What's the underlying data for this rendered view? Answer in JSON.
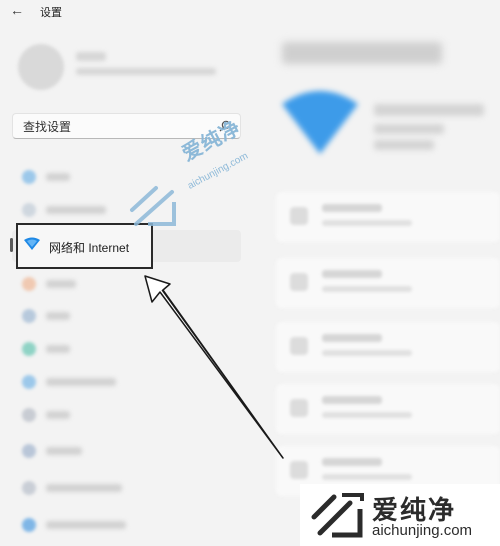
{
  "window": {
    "title": "设置",
    "back_glyph": "←"
  },
  "search": {
    "placeholder": "查找设置"
  },
  "nav": {
    "items": [
      {
        "icon": "system-icon",
        "color": "#9cc8ea",
        "active": false
      },
      {
        "icon": "bluetooth-devices-icon",
        "color": "#cfd7df",
        "active": false
      },
      {
        "icon": "network-internet-icon",
        "color": "#2f8fe0",
        "active": true,
        "label": "网络和 Internet"
      },
      {
        "icon": "personalization-icon",
        "color": "#f0c9b2",
        "active": false
      },
      {
        "icon": "apps-icon",
        "color": "#b7c9dc",
        "active": false
      },
      {
        "icon": "accounts-icon",
        "color": "#8fd3c5",
        "active": false
      },
      {
        "icon": "time-language-icon",
        "color": "#9cc8ea",
        "active": false
      },
      {
        "icon": "gaming-icon",
        "color": "#c8ccd3",
        "active": false
      },
      {
        "icon": "accessibility-icon",
        "color": "#b9c6d8",
        "active": false
      },
      {
        "icon": "privacy-security-icon",
        "color": "#c9ced6",
        "active": false
      },
      {
        "icon": "windows-update-icon",
        "color": "#7fb6e6",
        "active": false
      }
    ]
  },
  "highlight": {
    "label": "网络和 Internet"
  },
  "watermark": {
    "mid_text": "爱纯净",
    "mid_url": "aichunjing.com",
    "box_text": "爱纯净",
    "box_url": "aichunjing.com",
    "color": "#8db9d8"
  },
  "accent": "#0067c0"
}
